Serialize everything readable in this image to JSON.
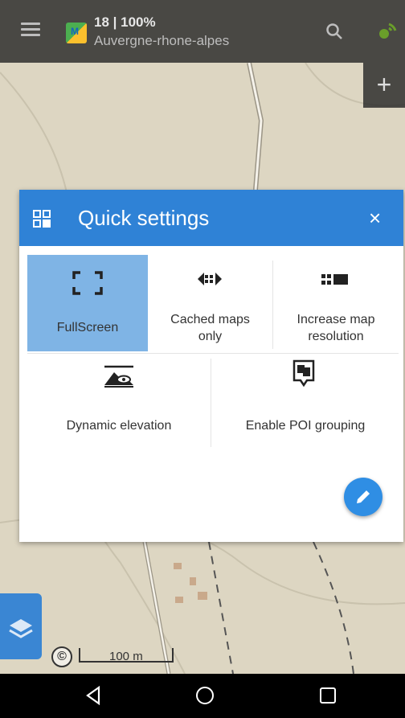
{
  "topbar": {
    "zoom_battery": "18 | 100%",
    "map_name": "Auvergne-rhone-alpes",
    "zoom_in_label": "+"
  },
  "quick_settings": {
    "title": "Quick settings",
    "close_label": "×",
    "tiles": [
      {
        "label": "FullScreen",
        "icon": "fullscreen-icon",
        "active": true
      },
      {
        "label": "Cached maps only",
        "icon": "cached-maps-icon",
        "active": false
      },
      {
        "label": "Increase map resolution",
        "icon": "map-resolution-icon",
        "active": false
      },
      {
        "label": "Dynamic elevation",
        "icon": "dynamic-elevation-icon",
        "active": false
      },
      {
        "label": "Enable POI grouping",
        "icon": "poi-grouping-icon",
        "active": false
      }
    ],
    "tile_lines": {
      "fullscreen": "FullScreen",
      "cached_1": "Cached maps",
      "cached_2": "only",
      "resolution_1": "Increase map",
      "resolution_2": "resolution",
      "elevation": "Dynamic elevation",
      "poi": "Enable POI grouping"
    },
    "accent": "#2f82d6",
    "active_tile_color": "#7fb4e5"
  },
  "map": {
    "copyright_symbol": "©",
    "scale_label": "100 m"
  }
}
